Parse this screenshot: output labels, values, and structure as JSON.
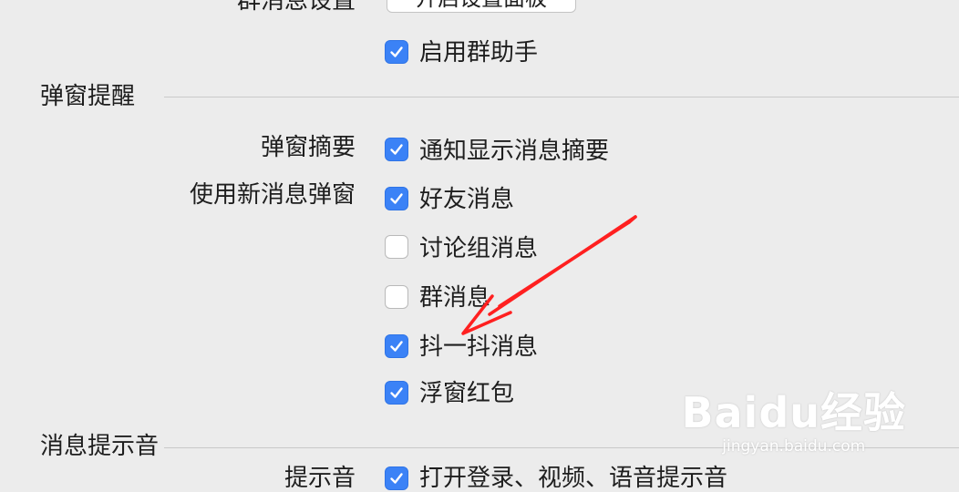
{
  "top": {
    "partial_label": "群消息设置",
    "panel_button": "开启设置面板",
    "enable_group_helper": {
      "label": "启用群助手",
      "checked": true
    }
  },
  "popup_section": {
    "title": "弹窗提醒",
    "summary_label": "弹窗摘要",
    "summary_option": {
      "label": "通知显示消息摘要",
      "checked": true
    },
    "new_popup_label": "使用新消息弹窗",
    "options": [
      {
        "label": "好友消息",
        "checked": true
      },
      {
        "label": "讨论组消息",
        "checked": false
      },
      {
        "label": "群消息",
        "checked": false
      },
      {
        "label": "抖一抖消息",
        "checked": true
      },
      {
        "label": "浮窗红包",
        "checked": true
      }
    ]
  },
  "sound_section": {
    "title": "消息提示音",
    "row_label": "提示音",
    "row_option": {
      "label": "打开登录、视频、语音提示音",
      "checked": true
    }
  },
  "watermark": {
    "brand": "Baidu经验",
    "url": "jingyan.baidu.com"
  },
  "colors": {
    "checkbox_on": "#3b82f6",
    "annotation_arrow": "#ff2020",
    "background": "#ececec"
  }
}
